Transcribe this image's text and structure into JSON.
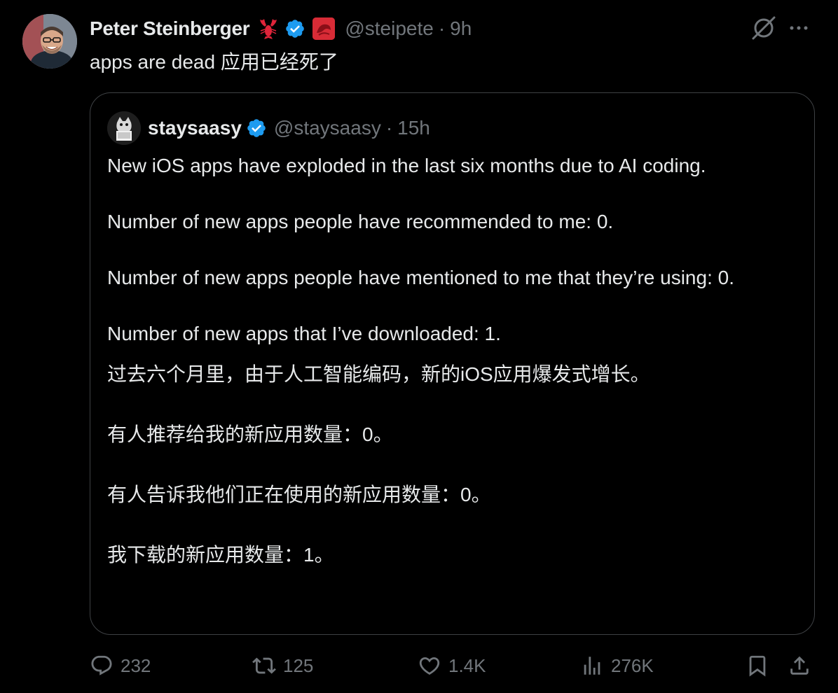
{
  "tweet": {
    "author": {
      "display_name": "Peter Steinberger",
      "handle": "@steipete",
      "time": "9h",
      "separator": "·",
      "badges": [
        "lobster-emoji",
        "verified-badge",
        "affiliate-badge"
      ]
    },
    "text": "apps are dead 应用已经死了",
    "quote": {
      "display_name": "staysaasy",
      "handle": "@staysaasy",
      "separator": "·",
      "time": "15h",
      "en_paragraphs": [
        "New iOS apps have exploded in the last six months due to AI coding.",
        "Number of new apps people have recommended to me: 0.",
        "Number of new apps people have mentioned to me that they’re using: 0.",
        "Number of new apps that I’ve downloaded: 1."
      ],
      "zh_paragraphs": [
        "过去六个月里，由于人工智能编码，新的iOS应用爆发式增长。",
        "有人推荐给我的新应用数量：0。",
        "有人告诉我他们正在使用的新应用数量：0。",
        "我下载的新应用数量：1。"
      ]
    },
    "stats": {
      "replies": "232",
      "reposts": "125",
      "likes": "1.4K",
      "views": "276K"
    }
  },
  "colors": {
    "background": "#000000",
    "text": "#e7e9ea",
    "muted": "#71767b",
    "border": "#3e4144",
    "verified": "#1d9bf0"
  },
  "icons": [
    "grok-icon",
    "more-icon",
    "reply-icon",
    "retweet-icon",
    "like-icon",
    "views-icon",
    "bookmark-icon",
    "share-icon"
  ]
}
